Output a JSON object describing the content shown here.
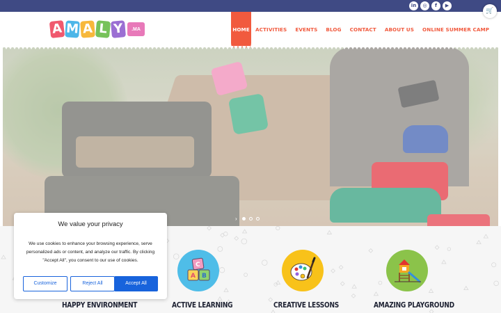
{
  "topbar": {
    "bg": "#3f4a84",
    "social": [
      {
        "icon": "linkedin-icon",
        "glyph": "in"
      },
      {
        "icon": "instagram-icon",
        "glyph": "◎"
      },
      {
        "icon": "facebook-icon",
        "glyph": "f"
      },
      {
        "icon": "youtube-icon",
        "glyph": "▶"
      }
    ]
  },
  "header": {
    "logo": {
      "letters": [
        "A",
        "M",
        "A",
        "L",
        "Y"
      ],
      "colors": [
        "#f0596e",
        "#4cb6e8",
        "#f7b83b",
        "#77c25a",
        "#9b6fd3"
      ],
      "suffix": ".MA"
    },
    "nav": [
      "HOME",
      "ACTIVITIES",
      "EVENTS",
      "BLOG",
      "CONTACT",
      "ABOUT US",
      "ONLINE SUMMER CAMP"
    ],
    "active_nav": "HOME",
    "accent": "#f15a3e",
    "cart_icon": "shopping-cart-icon"
  },
  "hero": {
    "slides_total": 3,
    "active_slide": 1
  },
  "features": [
    {
      "title": "HAPPY ENVIRONMENT",
      "color": ""
    },
    {
      "title": "ACTIVE LEARNING",
      "color": "#4fbde8",
      "icon": "alphabet-blocks-icon"
    },
    {
      "title": "CREATIVE LESSONS",
      "color": "#f8c21a",
      "icon": "paint-palette-icon"
    },
    {
      "title": "AMAZING PLAYGROUND",
      "color": "#8bc34a",
      "icon": "playground-slide-icon"
    }
  ],
  "cookie": {
    "title": "We value your privacy",
    "text": "We use cookies to enhance your browsing experience, serve personalized ads or content, and analyze our traffic. By clicking \"Accept All\", you consent to our use of cookies.",
    "customize": "Customize",
    "reject": "Reject All",
    "accept": "Accept All",
    "button_color": "#1863dc"
  }
}
